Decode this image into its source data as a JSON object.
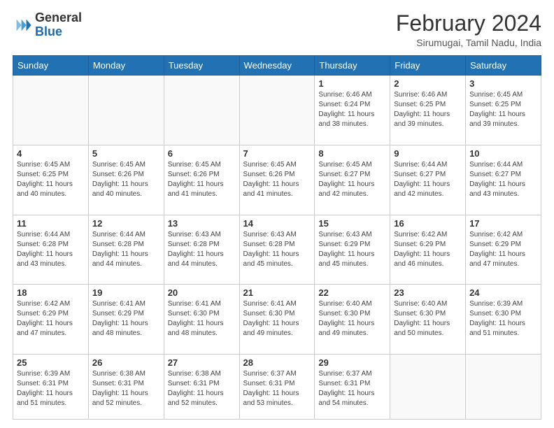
{
  "logo": {
    "general": "General",
    "blue": "Blue"
  },
  "header": {
    "month": "February 2024",
    "location": "Sirumugai, Tamil Nadu, India"
  },
  "weekdays": [
    "Sunday",
    "Monday",
    "Tuesday",
    "Wednesday",
    "Thursday",
    "Friday",
    "Saturday"
  ],
  "weeks": [
    [
      {
        "day": "",
        "info": ""
      },
      {
        "day": "",
        "info": ""
      },
      {
        "day": "",
        "info": ""
      },
      {
        "day": "",
        "info": ""
      },
      {
        "day": "1",
        "info": "Sunrise: 6:46 AM\nSunset: 6:24 PM\nDaylight: 11 hours\nand 38 minutes."
      },
      {
        "day": "2",
        "info": "Sunrise: 6:46 AM\nSunset: 6:25 PM\nDaylight: 11 hours\nand 39 minutes."
      },
      {
        "day": "3",
        "info": "Sunrise: 6:45 AM\nSunset: 6:25 PM\nDaylight: 11 hours\nand 39 minutes."
      }
    ],
    [
      {
        "day": "4",
        "info": "Sunrise: 6:45 AM\nSunset: 6:25 PM\nDaylight: 11 hours\nand 40 minutes."
      },
      {
        "day": "5",
        "info": "Sunrise: 6:45 AM\nSunset: 6:26 PM\nDaylight: 11 hours\nand 40 minutes."
      },
      {
        "day": "6",
        "info": "Sunrise: 6:45 AM\nSunset: 6:26 PM\nDaylight: 11 hours\nand 41 minutes."
      },
      {
        "day": "7",
        "info": "Sunrise: 6:45 AM\nSunset: 6:26 PM\nDaylight: 11 hours\nand 41 minutes."
      },
      {
        "day": "8",
        "info": "Sunrise: 6:45 AM\nSunset: 6:27 PM\nDaylight: 11 hours\nand 42 minutes."
      },
      {
        "day": "9",
        "info": "Sunrise: 6:44 AM\nSunset: 6:27 PM\nDaylight: 11 hours\nand 42 minutes."
      },
      {
        "day": "10",
        "info": "Sunrise: 6:44 AM\nSunset: 6:27 PM\nDaylight: 11 hours\nand 43 minutes."
      }
    ],
    [
      {
        "day": "11",
        "info": "Sunrise: 6:44 AM\nSunset: 6:28 PM\nDaylight: 11 hours\nand 43 minutes."
      },
      {
        "day": "12",
        "info": "Sunrise: 6:44 AM\nSunset: 6:28 PM\nDaylight: 11 hours\nand 44 minutes."
      },
      {
        "day": "13",
        "info": "Sunrise: 6:43 AM\nSunset: 6:28 PM\nDaylight: 11 hours\nand 44 minutes."
      },
      {
        "day": "14",
        "info": "Sunrise: 6:43 AM\nSunset: 6:28 PM\nDaylight: 11 hours\nand 45 minutes."
      },
      {
        "day": "15",
        "info": "Sunrise: 6:43 AM\nSunset: 6:29 PM\nDaylight: 11 hours\nand 45 minutes."
      },
      {
        "day": "16",
        "info": "Sunrise: 6:42 AM\nSunset: 6:29 PM\nDaylight: 11 hours\nand 46 minutes."
      },
      {
        "day": "17",
        "info": "Sunrise: 6:42 AM\nSunset: 6:29 PM\nDaylight: 11 hours\nand 47 minutes."
      }
    ],
    [
      {
        "day": "18",
        "info": "Sunrise: 6:42 AM\nSunset: 6:29 PM\nDaylight: 11 hours\nand 47 minutes."
      },
      {
        "day": "19",
        "info": "Sunrise: 6:41 AM\nSunset: 6:29 PM\nDaylight: 11 hours\nand 48 minutes."
      },
      {
        "day": "20",
        "info": "Sunrise: 6:41 AM\nSunset: 6:30 PM\nDaylight: 11 hours\nand 48 minutes."
      },
      {
        "day": "21",
        "info": "Sunrise: 6:41 AM\nSunset: 6:30 PM\nDaylight: 11 hours\nand 49 minutes."
      },
      {
        "day": "22",
        "info": "Sunrise: 6:40 AM\nSunset: 6:30 PM\nDaylight: 11 hours\nand 49 minutes."
      },
      {
        "day": "23",
        "info": "Sunrise: 6:40 AM\nSunset: 6:30 PM\nDaylight: 11 hours\nand 50 minutes."
      },
      {
        "day": "24",
        "info": "Sunrise: 6:39 AM\nSunset: 6:30 PM\nDaylight: 11 hours\nand 51 minutes."
      }
    ],
    [
      {
        "day": "25",
        "info": "Sunrise: 6:39 AM\nSunset: 6:31 PM\nDaylight: 11 hours\nand 51 minutes."
      },
      {
        "day": "26",
        "info": "Sunrise: 6:38 AM\nSunset: 6:31 PM\nDaylight: 11 hours\nand 52 minutes."
      },
      {
        "day": "27",
        "info": "Sunrise: 6:38 AM\nSunset: 6:31 PM\nDaylight: 11 hours\nand 52 minutes."
      },
      {
        "day": "28",
        "info": "Sunrise: 6:37 AM\nSunset: 6:31 PM\nDaylight: 11 hours\nand 53 minutes."
      },
      {
        "day": "29",
        "info": "Sunrise: 6:37 AM\nSunset: 6:31 PM\nDaylight: 11 hours\nand 54 minutes."
      },
      {
        "day": "",
        "info": ""
      },
      {
        "day": "",
        "info": ""
      }
    ]
  ]
}
